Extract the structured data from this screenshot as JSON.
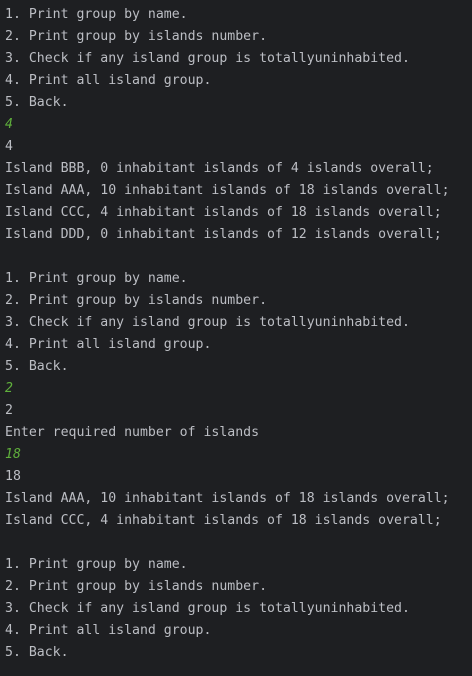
{
  "console": {
    "lines": [
      {
        "text": "1. Print group by name.",
        "kind": "output"
      },
      {
        "text": "2. Print group by islands number.",
        "kind": "output"
      },
      {
        "text": "3. Check if any island group is totallyuninhabited.",
        "kind": "output"
      },
      {
        "text": "4. Print all island group.",
        "kind": "output"
      },
      {
        "text": "5. Back.",
        "kind": "output"
      },
      {
        "text": "4",
        "kind": "input"
      },
      {
        "text": "4",
        "kind": "output"
      },
      {
        "text": "Island BBB, 0 inhabitant islands of 4 islands overall;",
        "kind": "output"
      },
      {
        "text": "Island AAA, 10 inhabitant islands of 18 islands overall;",
        "kind": "output"
      },
      {
        "text": "Island CCC, 4 inhabitant islands of 18 islands overall;",
        "kind": "output"
      },
      {
        "text": "Island DDD, 0 inhabitant islands of 12 islands overall;",
        "kind": "output"
      },
      {
        "text": "",
        "kind": "output"
      },
      {
        "text": "1. Print group by name.",
        "kind": "output"
      },
      {
        "text": "2. Print group by islands number.",
        "kind": "output"
      },
      {
        "text": "3. Check if any island group is totallyuninhabited.",
        "kind": "output"
      },
      {
        "text": "4. Print all island group.",
        "kind": "output"
      },
      {
        "text": "5. Back.",
        "kind": "output"
      },
      {
        "text": "2",
        "kind": "input"
      },
      {
        "text": "2",
        "kind": "output"
      },
      {
        "text": "Enter required number of islands",
        "kind": "output"
      },
      {
        "text": "18",
        "kind": "input"
      },
      {
        "text": "18",
        "kind": "output"
      },
      {
        "text": "Island AAA, 10 inhabitant islands of 18 islands overall;",
        "kind": "output"
      },
      {
        "text": "Island CCC, 4 inhabitant islands of 18 islands overall;",
        "kind": "output"
      },
      {
        "text": "",
        "kind": "output"
      },
      {
        "text": "1. Print group by name.",
        "kind": "output"
      },
      {
        "text": "2. Print group by islands number.",
        "kind": "output"
      },
      {
        "text": "3. Check if any island group is totallyuninhabited.",
        "kind": "output"
      },
      {
        "text": "4. Print all island group.",
        "kind": "output"
      },
      {
        "text": "5. Back.",
        "kind": "output"
      }
    ]
  },
  "colors": {
    "background": "#1e1f22",
    "output_text": "#bcbec4",
    "user_input_text": "#5faf3c"
  }
}
